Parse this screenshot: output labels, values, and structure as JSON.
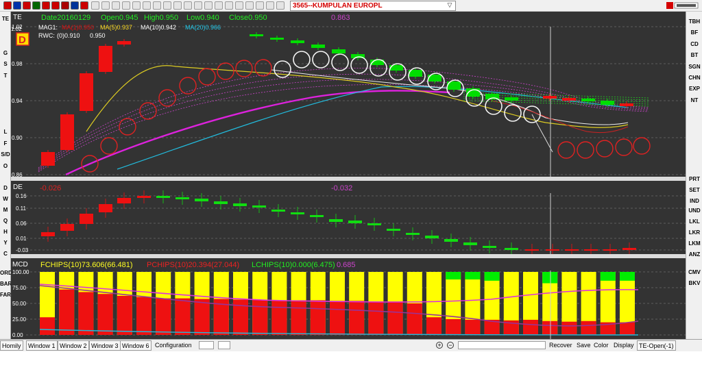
{
  "toolbar": {
    "stock_selector": "3565--KUMPULAN EUROPL",
    "icons": [
      "flag-icon",
      "flag-icon",
      "flag-icon",
      "flag-icon",
      "flag-icon",
      "flag-icon",
      "flag-icon",
      "flag-icon",
      "flag-icon",
      "calendar-icon",
      "grid-icon",
      "home-icon",
      "chart-icon",
      "arrow-left-icon",
      "arrow-right-icon",
      "refresh-icon",
      "zoom-in-icon",
      "zoom-out-icon",
      "tool-icon",
      "image-icon",
      "zoom-icon",
      "house-icon",
      "folder-icon",
      "folder-icon",
      "folder-icon",
      "lock-icon",
      "save-icon",
      "copy-icon",
      "dollar-icon",
      "settings-icon"
    ]
  },
  "left_bar": {
    "top_items": [
      "TE",
      "",
      "",
      "G",
      "S",
      "T",
      "",
      "",
      "",
      "",
      "L",
      "F",
      "S/D",
      "O"
    ],
    "lower_items": [
      "D",
      "W",
      "M",
      "Q",
      "H",
      "Y",
      "C"
    ],
    "bottom_items": [
      "ORD",
      "BAR",
      "FAR"
    ]
  },
  "right_bar": {
    "top_items": [
      "TBH",
      "BF",
      "CD",
      "BT",
      "SGN",
      "CHN",
      "EXP",
      "NT",
      "",
      "",
      "",
      "",
      "",
      "",
      "PRT",
      "SET",
      "IND"
    ],
    "middle_items": [
      "UND",
      "LKL",
      "LKR",
      "LKM",
      "ANZ"
    ],
    "bottom_items": [
      "CMV",
      "BKV"
    ]
  },
  "price_panel": {
    "label": "TE",
    "info": {
      "date": "Date20160129",
      "open": "Open0.945",
      "high": "High0.950",
      "low": "Low0.940",
      "close": "Close0.950",
      "value": "0.863"
    },
    "ma_legend": {
      "mag": "MAG1:",
      "ma_red": "MA(1)0.950",
      "ma5": "MA(5)0.937",
      "ma10": "MA(10)0.942",
      "ma20": "MA(20)0.966"
    },
    "rwc": {
      "label": "RWC:",
      "v1": "(0)0.910",
      "v2": "0.950"
    },
    "badge": "D",
    "y_ticks": [
      "1.02",
      "0.98",
      "0.94",
      "0.90",
      "0.86"
    ],
    "colors": {
      "up": "#00dd00",
      "down": "#ee1111",
      "bg": "#333333"
    }
  },
  "de_panel": {
    "label": "DE",
    "value_left": "-0.026",
    "value_mid": "-0.032",
    "y_ticks": [
      "0.16",
      "0.11",
      "0.06",
      "0.01",
      "-0.03"
    ]
  },
  "mcd_panel": {
    "label": "MCD",
    "fchips": "FCHIPS(10)73.606(66.481)",
    "pchips": "PCHIPS(10)20.394(27.044)",
    "lchips": "LCHIPS(10)0.000(6.475)",
    "extra": "0.685",
    "y_ticks": [
      "100.00",
      "75.00",
      "50.00",
      "25.00",
      "0.00"
    ]
  },
  "bottom_bar": {
    "left_tab": "Homily",
    "windows": [
      "Window 1",
      "Window 2",
      "Window 3",
      "Window 6"
    ],
    "configuration": "Configuration",
    "actions": [
      "Recover",
      "Save",
      "Color",
      "Display"
    ],
    "status": "TE-Open(-1)"
  }
}
